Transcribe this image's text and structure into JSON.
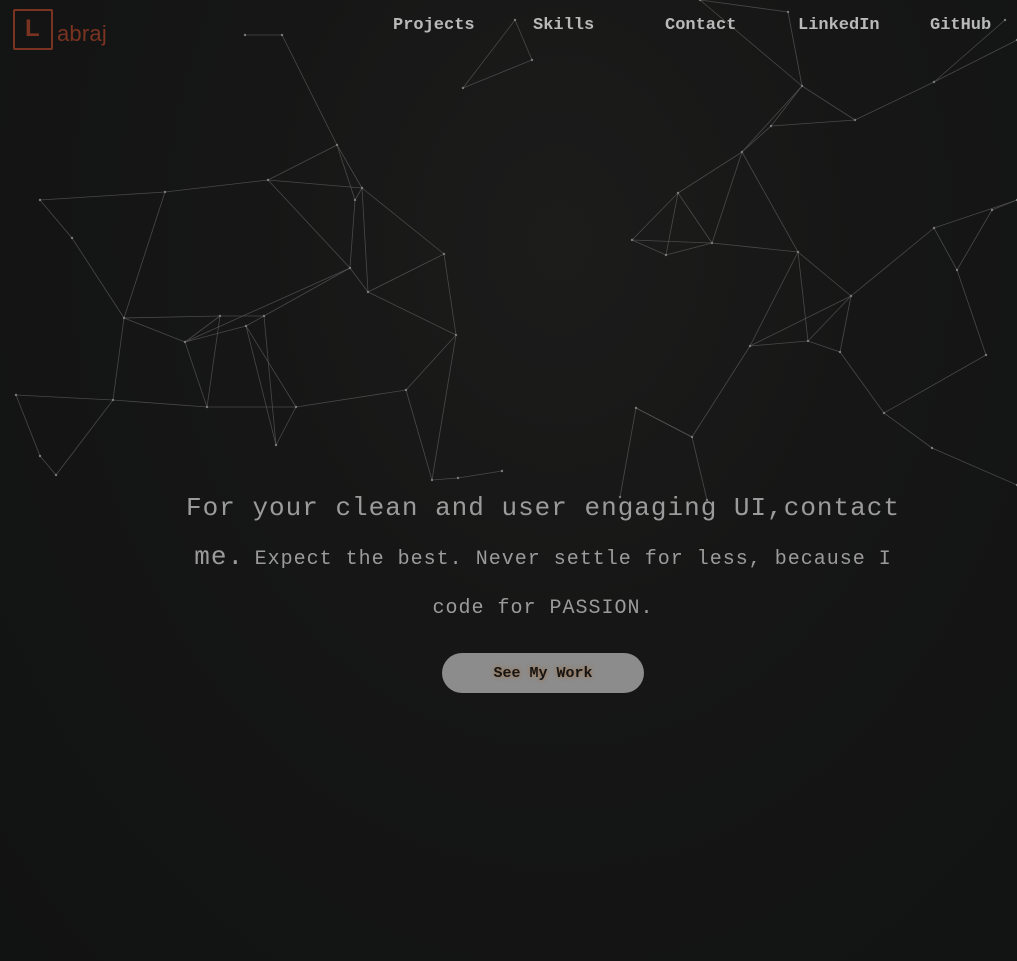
{
  "logo": {
    "letter": "L",
    "text": "abraj",
    "accent_color": "#7a3320"
  },
  "nav": {
    "projects": "Projects",
    "skills": "Skills",
    "contact": "Contact",
    "linkedin": "LinkedIn",
    "github": "GitHub"
  },
  "hero": {
    "line_big": "For your clean and user engaging UI,contact me.",
    "line_small": "Expect the best. Never settle for less, because I code for PASSION."
  },
  "cta": {
    "label": "See My Work"
  },
  "colors": {
    "background": "#121212",
    "text": "#9b9b9b",
    "nav_text": "#b9b9b9",
    "button": "#8c8c8c",
    "network_lines": "#5a5a5a"
  }
}
